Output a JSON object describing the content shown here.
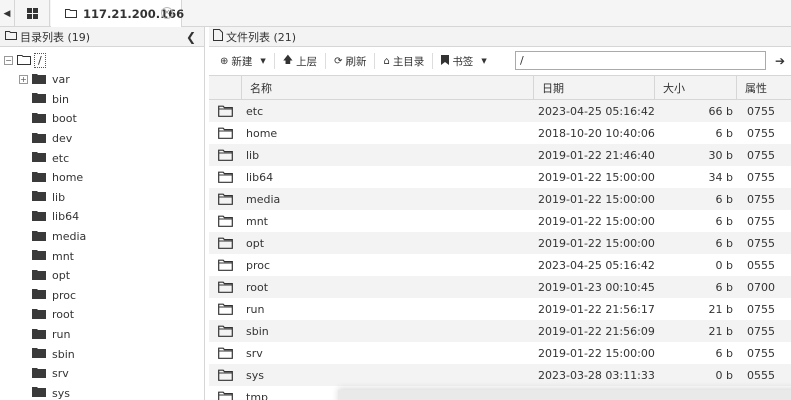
{
  "tabs": [
    {
      "label": "117.21.200.166",
      "active": true
    }
  ],
  "left_panel": {
    "title": "目录列表 (19)",
    "root": "/",
    "items": [
      "var",
      "bin",
      "boot",
      "dev",
      "etc",
      "home",
      "lib",
      "lib64",
      "media",
      "mnt",
      "opt",
      "proc",
      "root",
      "run",
      "sbin",
      "srv",
      "sys"
    ]
  },
  "right_panel": {
    "title": "文件列表 (21)",
    "toolbar": {
      "new": "新建",
      "up": "上层",
      "refresh": "刷新",
      "home": "主目录",
      "bookmark": "书签",
      "path": "/"
    },
    "columns": {
      "name": "名称",
      "date": "日期",
      "size": "大小",
      "attr": "属性"
    },
    "files": [
      {
        "name": "etc",
        "date": "2023-04-25 05:16:42",
        "size": "66 b",
        "attr": "0755"
      },
      {
        "name": "home",
        "date": "2018-10-20 10:40:06",
        "size": "6 b",
        "attr": "0755"
      },
      {
        "name": "lib",
        "date": "2019-01-22 21:46:40",
        "size": "30 b",
        "attr": "0755"
      },
      {
        "name": "lib64",
        "date": "2019-01-22 15:00:00",
        "size": "34 b",
        "attr": "0755"
      },
      {
        "name": "media",
        "date": "2019-01-22 15:00:00",
        "size": "6 b",
        "attr": "0755"
      },
      {
        "name": "mnt",
        "date": "2019-01-22 15:00:00",
        "size": "6 b",
        "attr": "0755"
      },
      {
        "name": "opt",
        "date": "2019-01-22 15:00:00",
        "size": "6 b",
        "attr": "0755"
      },
      {
        "name": "proc",
        "date": "2023-04-25 05:16:42",
        "size": "0 b",
        "attr": "0555"
      },
      {
        "name": "root",
        "date": "2019-01-23 00:10:45",
        "size": "6 b",
        "attr": "0700"
      },
      {
        "name": "run",
        "date": "2019-01-22 21:56:17",
        "size": "21 b",
        "attr": "0755"
      },
      {
        "name": "sbin",
        "date": "2019-01-22 21:56:09",
        "size": "21 b",
        "attr": "0755"
      },
      {
        "name": "srv",
        "date": "2019-01-22 15:00:00",
        "size": "6 b",
        "attr": "0755"
      },
      {
        "name": "sys",
        "date": "2023-03-28 03:11:33",
        "size": "0 b",
        "attr": "0555"
      },
      {
        "name": "tmp",
        "date": "",
        "size": "",
        "attr": ""
      }
    ]
  }
}
